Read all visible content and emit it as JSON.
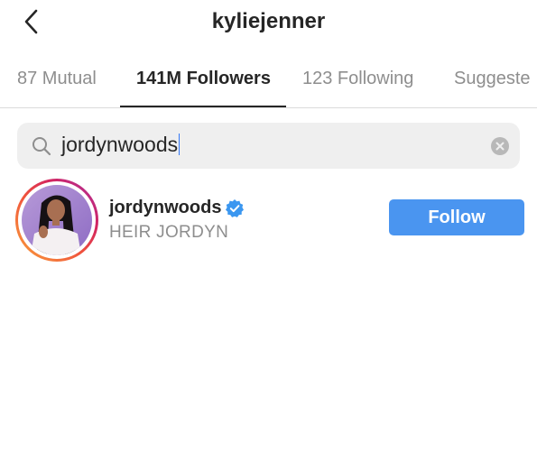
{
  "header": {
    "title": "kyliejenner",
    "back_icon": "chevron-left-icon"
  },
  "tabs": [
    {
      "label": "87 Mutual",
      "active": false
    },
    {
      "label": "141M Followers",
      "active": true
    },
    {
      "label": "123 Following",
      "active": false
    },
    {
      "label": "Suggeste",
      "active": false
    }
  ],
  "search": {
    "value": "jordynwoods",
    "icon": "search-icon",
    "clear_icon": "clear-icon"
  },
  "results": [
    {
      "username": "jordynwoods",
      "full_name": "HEIR JORDYN",
      "verified": true,
      "follow_label": "Follow"
    }
  ],
  "colors": {
    "follow_button": "#4a95f0",
    "verified_badge": "#3b97f0",
    "text_primary": "#262626",
    "text_secondary": "#8e8e8e"
  }
}
